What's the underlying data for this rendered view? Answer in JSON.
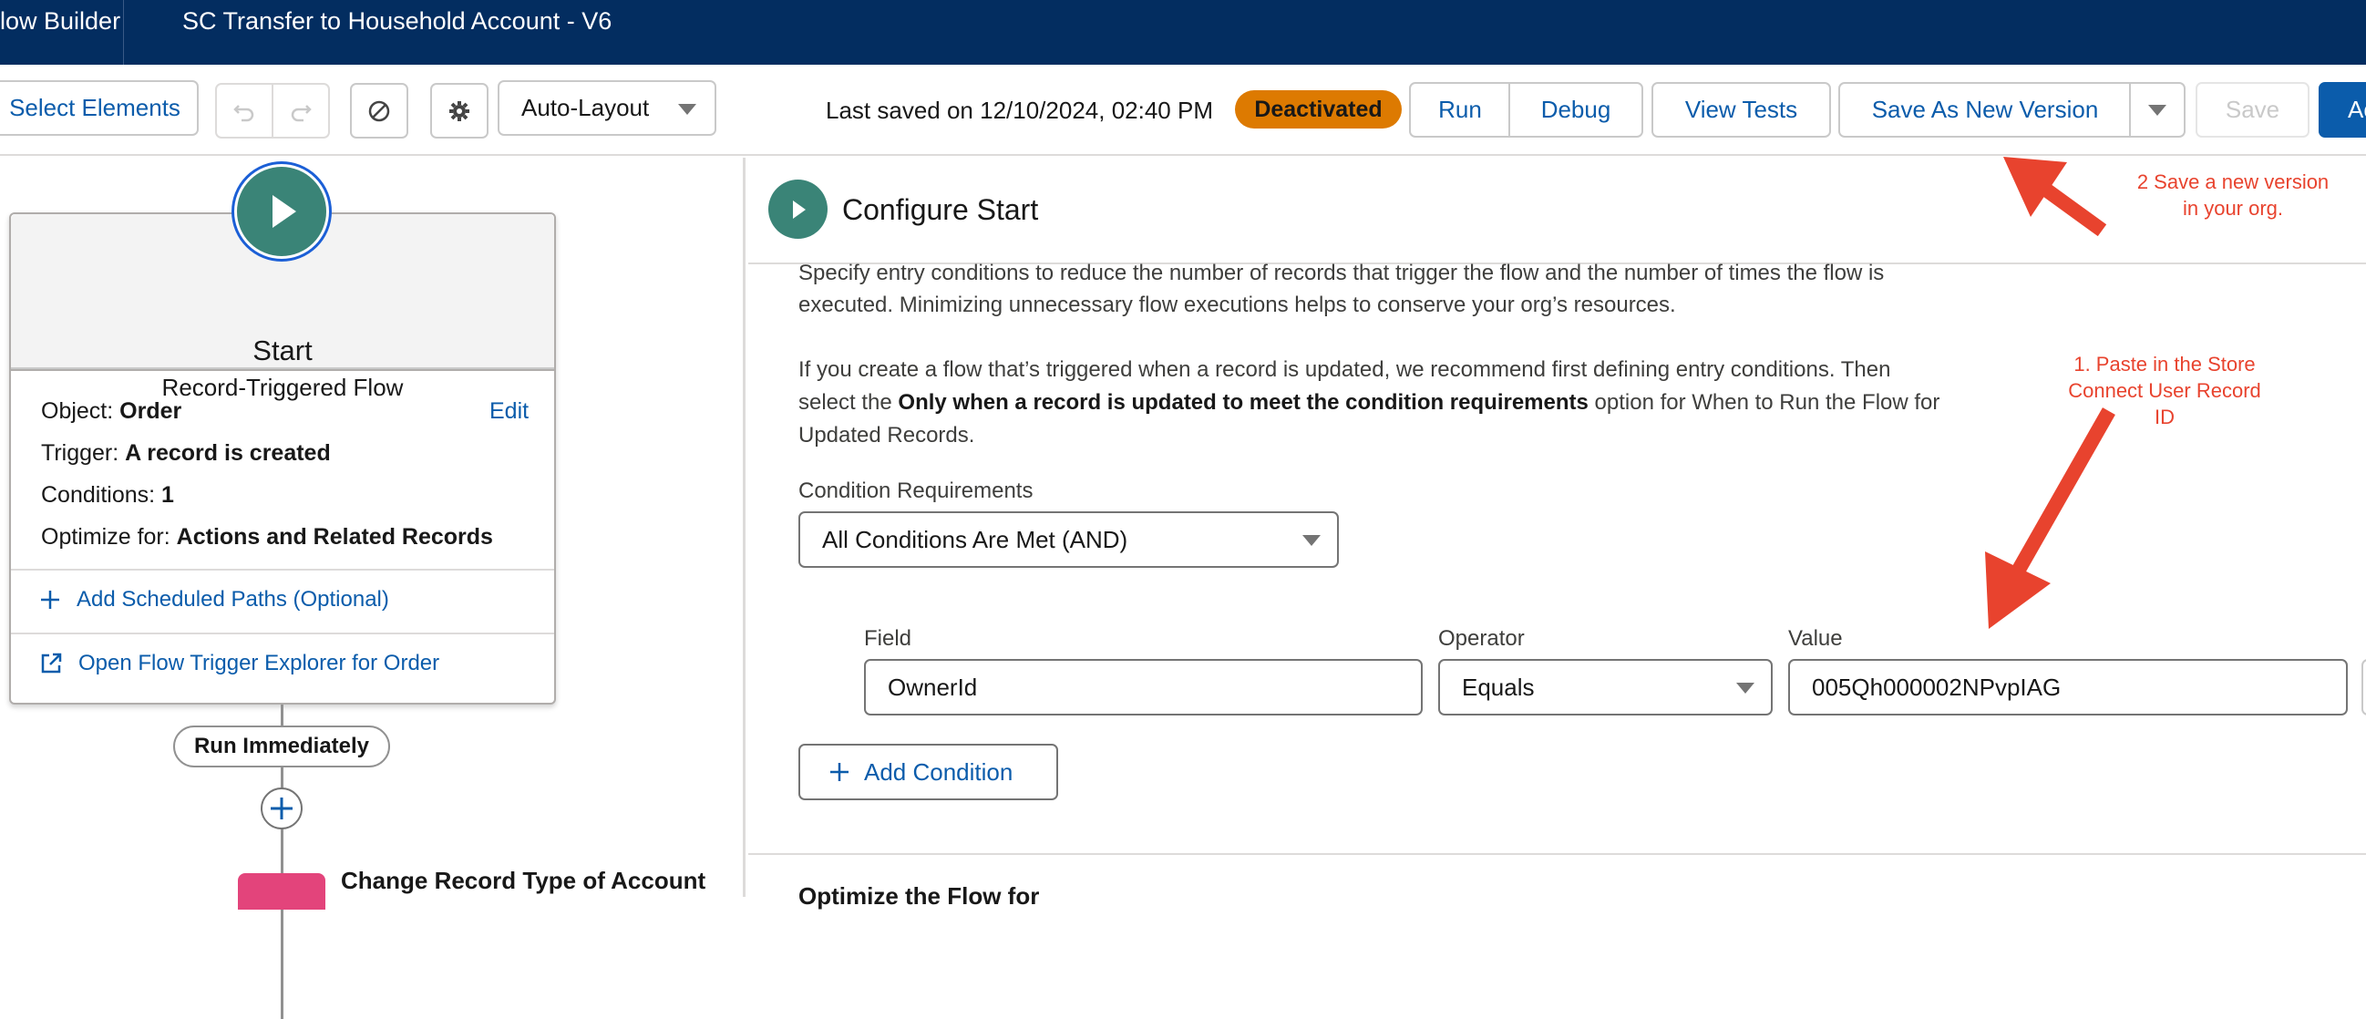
{
  "topbar": {
    "app_title": "low Builder",
    "flow_title": "SC Transfer to Household Account - V6"
  },
  "toolbar": {
    "select_elements": "Select Elements",
    "layout_select": "Auto-Layout",
    "last_saved": "Last saved on 12/10/2024, 02:40 PM",
    "status_badge": "Deactivated",
    "run": "Run",
    "debug": "Debug",
    "view_tests": "View Tests",
    "save_as_new_version": "Save As New Version",
    "save": "Save",
    "activate_partial": "Ac"
  },
  "canvas": {
    "start_title": "Start",
    "start_subtitle": "Record-Triggered Flow",
    "object_label": "Object:",
    "object_value": "Order",
    "edit": "Edit",
    "trigger_label": "Trigger:",
    "trigger_value": "A record is created",
    "conditions_label": "Conditions:",
    "conditions_value": "1",
    "optimize_label": "Optimize for:",
    "optimize_value": "Actions and Related Records",
    "add_scheduled_paths": "Add Scheduled Paths (Optional)",
    "open_trigger_explorer": "Open Flow Trigger Explorer for Order",
    "run_immediately": "Run Immediately",
    "next_element": "Change Record Type of Account"
  },
  "panel": {
    "title": "Configure Start",
    "desc1_line1": "Specify entry conditions to reduce the number of records that trigger the flow and the number of times the flow is",
    "desc1_line2": "executed. Minimizing unnecessary flow executions helps to conserve your org’s resources.",
    "desc2_line1": "If you create a flow that’s triggered when a record is updated, we recommend first defining entry conditions. Then",
    "desc2_line2_pre": "select the ",
    "desc2_line2_bold": "Only when a record is updated to meet the condition requirements",
    "desc2_line2_post": " option for When to Run the Flow for",
    "desc2_line3": "Updated Records.",
    "condition_requirements_label": "Condition Requirements",
    "condition_requirements_value": "All Conditions Are Met (AND)",
    "field_label": "Field",
    "field_value": "OwnerId",
    "operator_label": "Operator",
    "operator_value": "Equals",
    "value_label": "Value",
    "value_value": "005Qh000002NPvpIAG",
    "add_condition": "Add Condition",
    "next_section": "Optimize the Flow for"
  },
  "annotations": {
    "note2_line1": "2  Save a new version",
    "note2_line2": "in your org.",
    "note1_line1": "1. Paste in the Store",
    "note1_line2": "Connect User Record",
    "note1_line3": "ID",
    "arrow_color": "#e8432e"
  },
  "colors": {
    "header_bg": "#032d60",
    "link": "#0b5cab",
    "badge": "#dd7a01",
    "start_node": "#3a8477",
    "action_node": "#e3447b"
  },
  "icons": [
    "undo-icon",
    "redo-icon",
    "cancel-icon",
    "gear-icon",
    "chevron-down-icon",
    "play-icon",
    "plus-icon",
    "external-link-icon",
    "add-node-icon"
  ]
}
